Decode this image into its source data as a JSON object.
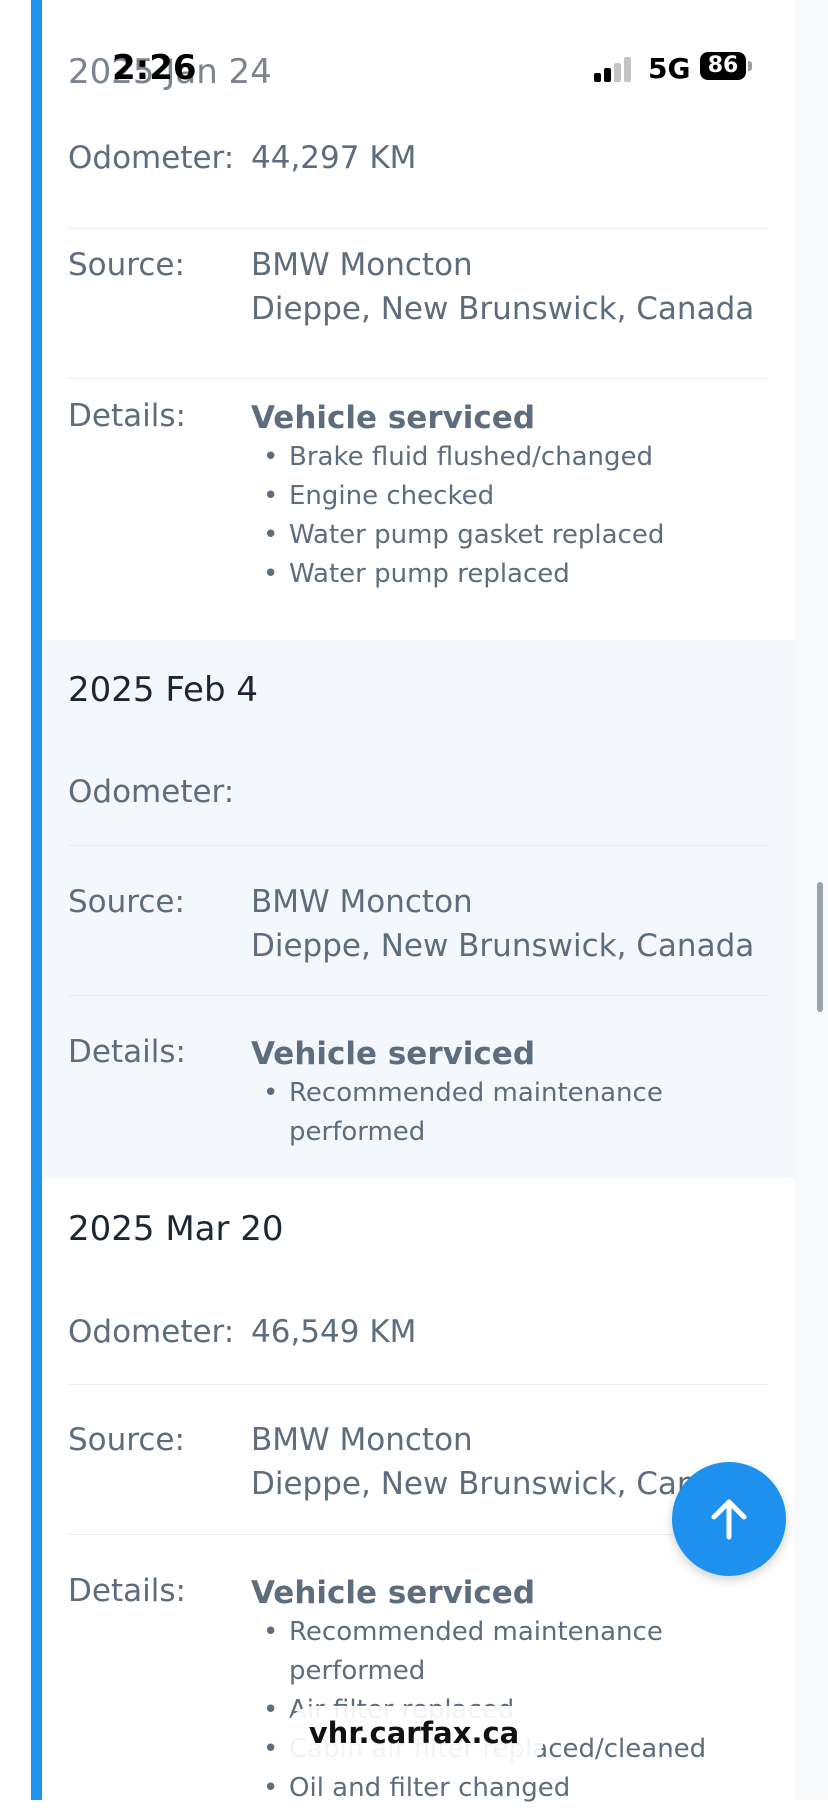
{
  "status_bar": {
    "time": "2:26",
    "network": "5G",
    "battery": "86"
  },
  "entries": [
    {
      "date": "2025 Jan 24",
      "odometer_label": "Odometer:",
      "odometer": "44,297 KM",
      "source_label": "Source:",
      "source_name": "BMW Moncton",
      "source_location": "Dieppe, New Brunswick, Canada",
      "details_label": "Details:",
      "details_title": "Vehicle serviced",
      "details_items": [
        "Brake fluid flushed/changed",
        "Engine checked",
        "Water pump gasket replaced",
        "Water pump replaced"
      ]
    },
    {
      "date": "2025 Feb 4",
      "odometer_label": "Odometer:",
      "odometer": "",
      "source_label": "Source:",
      "source_name": "BMW Moncton",
      "source_location": "Dieppe, New Brunswick, Canada",
      "details_label": "Details:",
      "details_title": "Vehicle serviced",
      "details_items": [
        "Recommended maintenance performed"
      ]
    },
    {
      "date": "2025 Mar 20",
      "odometer_label": "Odometer:",
      "odometer": "46,549 KM",
      "source_label": "Source:",
      "source_name": "BMW Moncton",
      "source_location": "Dieppe, New Brunswick, Canada",
      "details_label": "Details:",
      "details_title": "Vehicle serviced",
      "details_items": [
        "Recommended maintenance performed",
        "Air filter replaced",
        "Cabin air filter replaced/cleaned",
        "Oil and filter changed"
      ]
    }
  ],
  "browser": {
    "url": "vhr.carfax.ca"
  },
  "icons": {
    "scroll_top": "arrow-up-icon"
  },
  "colors": {
    "accent": "#1f93ee",
    "fab": "#1e90ee",
    "alt_row": "#f4f8fc"
  }
}
